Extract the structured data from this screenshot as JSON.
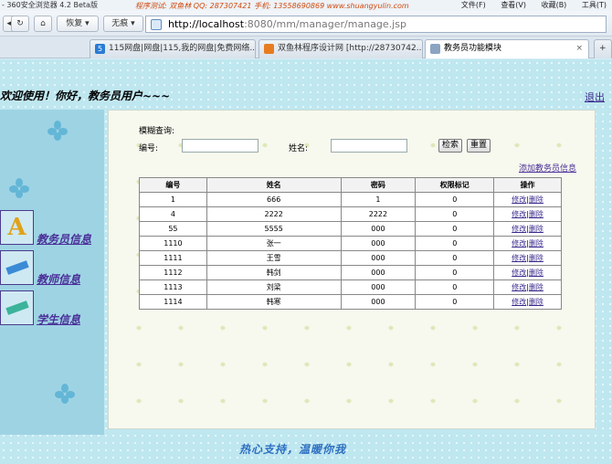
{
  "browser": {
    "app_title": "- 360安全浏览器 4.2 Beta版",
    "credits": "程序测试: 双鱼林   QQ: 287307421   手机: 13558690869   www.shuangyulin.com",
    "menus": [
      "文件(F)",
      "查看(V)",
      "收藏(B)",
      "工具(T)"
    ],
    "toolbar": {
      "restore": "恢复",
      "incognito": "无痕"
    },
    "address": {
      "host": "http://localhost",
      "path": ":8080/mm/manager/manage.jsp"
    },
    "tabs": [
      {
        "label": "115网盘|网盘|115,我的网盘|免费网络..."
      },
      {
        "label": "双鱼林程序设计网 [http://28730742..."
      },
      {
        "label": "教务员功能模块"
      }
    ]
  },
  "page": {
    "welcome": "欢迎使用！你好，教务员用户~~~",
    "logout": "退出",
    "nav": [
      {
        "label": "教务员信息",
        "icon": "letter-a-icon",
        "icon_char": "A"
      },
      {
        "label": "教师信息",
        "icon": "teacher-icon"
      },
      {
        "label": "学生信息",
        "icon": "student-icon"
      }
    ],
    "query": {
      "title": "模糊查询:",
      "no_label": "编号:",
      "name_label": "姓名:",
      "search_button": "检索",
      "reset_button": "重置"
    },
    "add_link": "添加教务员信息",
    "table": {
      "headers": [
        "编号",
        "姓名",
        "密码",
        "权限标记",
        "操作"
      ],
      "edit_label": "修改",
      "delete_label": "删除",
      "separator": "|",
      "rows": [
        [
          "1",
          "666",
          "1",
          "0"
        ],
        [
          "4",
          "2222",
          "2222",
          "0"
        ],
        [
          "55",
          "5555",
          "000",
          "0"
        ],
        [
          "1110",
          "张一",
          "000",
          "0"
        ],
        [
          "1111",
          "王雪",
          "000",
          "0"
        ],
        [
          "1112",
          "韩剑",
          "000",
          "0"
        ],
        [
          "1113",
          "刘梁",
          "000",
          "0"
        ],
        [
          "1114",
          "韩寒",
          "000",
          "0"
        ]
      ]
    },
    "footer": "热心支持，温暖你我"
  }
}
